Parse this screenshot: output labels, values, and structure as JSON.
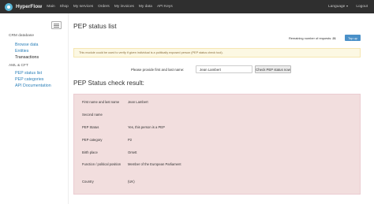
{
  "navbar": {
    "brand": "HyperFlow",
    "links": [
      "Main",
      "Shop",
      "My services",
      "Orders",
      "My invoices",
      "My data",
      "API Keys"
    ],
    "language": "Language",
    "logout": "Logout"
  },
  "sidebar": {
    "sections": [
      {
        "header": "CRM database",
        "items": [
          {
            "label": "Browse data",
            "active": false
          },
          {
            "label": "Entities",
            "active": false
          },
          {
            "label": "Transactions",
            "active": true
          }
        ]
      },
      {
        "header": "AML & CFT",
        "items": [
          {
            "label": "PEP status list",
            "active": false
          },
          {
            "label": "PEP categories",
            "active": false
          },
          {
            "label": "API Documentation",
            "active": false
          }
        ]
      }
    ]
  },
  "main": {
    "title": "PEP status list",
    "remaining_label": "Remaining number of requests:",
    "remaining_count": "21",
    "top_up_label": "Top up",
    "notice": "This module could be used to verify if given individual is a politically exposed person (PEP status check tool).",
    "form": {
      "label": "Please provide first and last name:",
      "input_value": "Jean Lambert",
      "button_label": "Check PEP status now"
    },
    "result_title": "PEP Status check result:",
    "result_rows": [
      {
        "label": "First name and last name",
        "value": "Jean Lambert"
      },
      {
        "label": "Second name",
        "value": ""
      },
      {
        "label": "PEP Status",
        "value": "Yes, this person is a PEP"
      },
      {
        "label": "PEP category",
        "value": "P2"
      },
      {
        "label": "Birth place",
        "value": "Orsett"
      },
      {
        "label": "Function / political position",
        "value": "Member of the European Parliament"
      },
      {
        "label": "Country",
        "value": "(UK)"
      }
    ]
  },
  "colors": {
    "navbar_bg": "#2f2f2f",
    "link": "#2a7fb8",
    "primary_button": "#4a90c8",
    "warning_bg": "#fcf8e3",
    "danger_bg": "#f2dede"
  }
}
